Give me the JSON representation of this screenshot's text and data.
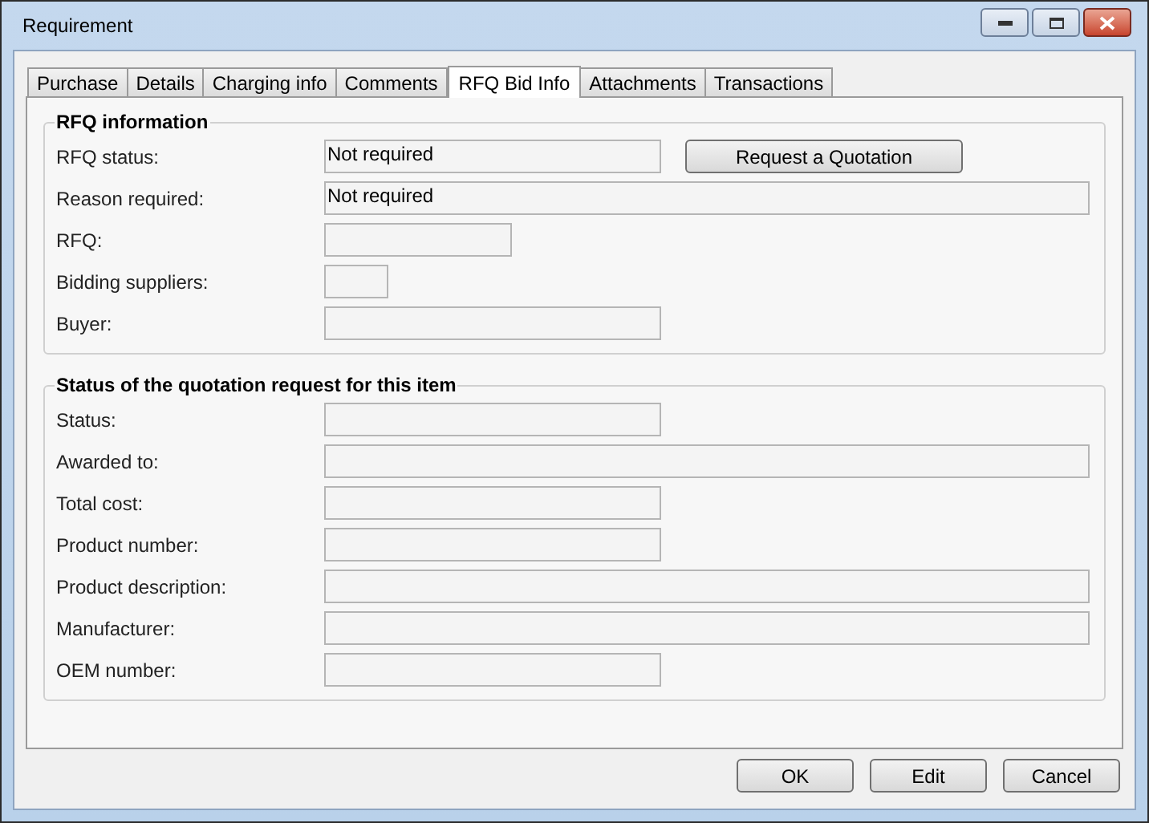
{
  "window": {
    "title": "Requirement"
  },
  "tabs": [
    {
      "label": "Purchase",
      "selected": false
    },
    {
      "label": "Details",
      "selected": false
    },
    {
      "label": "Charging info",
      "selected": false
    },
    {
      "label": "Comments",
      "selected": false
    },
    {
      "label": "RFQ Bid Info",
      "selected": true
    },
    {
      "label": "Attachments",
      "selected": false
    },
    {
      "label": "Transactions",
      "selected": false
    }
  ],
  "groups": [
    {
      "title": "RFQ information",
      "fields": [
        {
          "label": "RFQ status:",
          "value": "Not required",
          "kind": "medium",
          "button": "Request a Quotation"
        },
        {
          "label": "Reason required:",
          "value": "Not required",
          "kind": "long"
        },
        {
          "label": "RFQ:",
          "kind": "short"
        },
        {
          "label": "Bidding suppliers:",
          "kind": "tiny"
        },
        {
          "label": "Buyer:",
          "kind": "medium"
        }
      ]
    },
    {
      "title": "Status of the quotation request for this item",
      "fields": [
        {
          "label": "Status:",
          "kind": "medium"
        },
        {
          "label": "Awarded to:",
          "kind": "long"
        },
        {
          "label": "Total cost:",
          "kind": "medium"
        },
        {
          "label": "Product number:",
          "kind": "medium"
        },
        {
          "label": "Product description:",
          "kind": "long"
        },
        {
          "label": "Manufacturer:",
          "kind": "long"
        },
        {
          "label": "OEM number:",
          "kind": "medium"
        }
      ]
    }
  ],
  "buttons": [
    "OK",
    "Edit",
    "Cancel"
  ]
}
